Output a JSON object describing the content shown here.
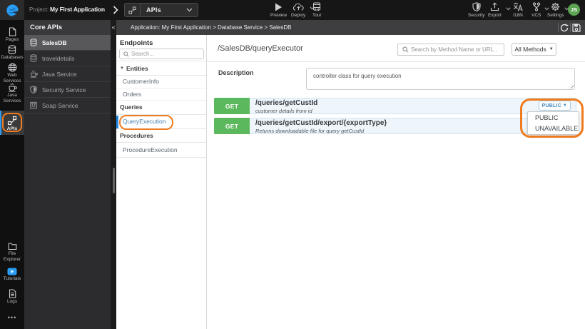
{
  "colors": {
    "annotation_orange": "#ee7b1e",
    "method_get_green": "#5cb85c",
    "active_blue": "#2f9bf2",
    "row_background": "#eef6fc",
    "avatar_green": "#5ca352"
  },
  "topbar": {
    "project_label": "Project:",
    "project_name": "My First Application",
    "mode_selector": {
      "label": "APIs",
      "icon": "api-icon"
    },
    "actions_left": [
      {
        "label": "Preview",
        "icon": "play-icon"
      },
      {
        "label": "Deploy",
        "icon": "cloud-upload-icon",
        "has_caret": true
      },
      {
        "label": "Tour",
        "icon": "bus-icon"
      }
    ],
    "actions_right": [
      {
        "label": "Security",
        "icon": "shield-icon"
      },
      {
        "label": "Export",
        "icon": "export-icon",
        "has_caret": true
      },
      {
        "label": "I18N",
        "icon": "translate-icon"
      },
      {
        "label": "VCS",
        "icon": "branch-icon",
        "has_caret": true
      },
      {
        "label": "Settings",
        "icon": "gear-icon",
        "has_caret": true
      }
    ],
    "avatar_initials": "JS"
  },
  "rail": {
    "items": [
      {
        "label": "Pages",
        "icon": "page-icon"
      },
      {
        "label": "Databases",
        "icon": "database-icon"
      },
      {
        "label": "Web Services",
        "icon": "globe-icon"
      },
      {
        "label": "Java Services",
        "icon": "coffee-icon"
      },
      {
        "label": "APIs",
        "icon": "api-icon",
        "active": true
      }
    ],
    "bottom_items": [
      {
        "label": "File Explorer",
        "icon": "folder-icon"
      },
      {
        "label": "Tutorials",
        "icon": "video-icon"
      },
      {
        "label": "Logs",
        "icon": "log-icon"
      }
    ],
    "more": "•••"
  },
  "services_panel": {
    "title": "Core APIs",
    "collapse_icon": "«",
    "items": [
      {
        "label": "SalesDB",
        "icon": "database-icon",
        "selected": true
      },
      {
        "label": "traveldetails",
        "icon": "database-icon"
      },
      {
        "label": "Java Service",
        "icon": "coffee-icon"
      },
      {
        "label": "Security Service",
        "icon": "shield-icon"
      },
      {
        "label": "Soap Service",
        "icon": "soap-icon"
      }
    ]
  },
  "breadcrumb": {
    "text": "Application: My First Application > Database Service > SalesDB"
  },
  "endpoints_panel": {
    "title": "Endpoints",
    "search_placeholder": "Search...",
    "sections": [
      {
        "header": "Entities",
        "expanded": true,
        "items": [
          "CustomerInfo",
          "Orders"
        ]
      },
      {
        "header": "Queries",
        "items": [
          "QueryExecution"
        ],
        "selected_item": "QueryExecution"
      },
      {
        "header": "Procedures",
        "items": [
          "ProcedureExecution"
        ]
      }
    ]
  },
  "main": {
    "title": "/SalesDB/queryExecutor",
    "search_placeholder": "Search by Method Name or URL...",
    "methods_filter_label": "All Methods",
    "description_label": "Description",
    "description_value": "controller class for query execution",
    "endpoints": [
      {
        "method": "GET",
        "path": "/queries/getCustId",
        "description": "customer details from id",
        "visibility": "PUBLIC"
      },
      {
        "method": "GET",
        "path": "/queries/getCustId/export/{exportType}",
        "description": "Returns downloadable file for query getCustId"
      }
    ],
    "visibility_menu": [
      "PUBLIC",
      "UNAVAILABLE"
    ]
  }
}
